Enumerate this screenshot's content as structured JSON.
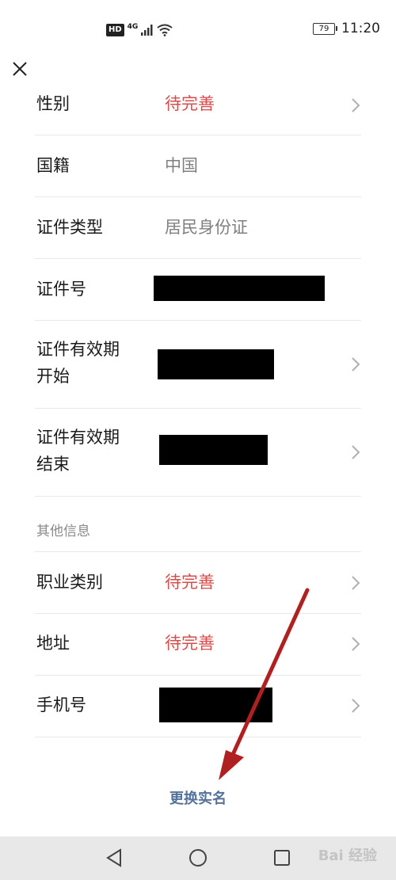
{
  "status_bar": {
    "network_badge": "HD",
    "network_type": "4G",
    "battery_level": "79",
    "time": "11:20"
  },
  "rows": [
    {
      "label": "性别",
      "value": "待完善",
      "value_style": "red",
      "chevron": true
    },
    {
      "label": "国籍",
      "value": "中国",
      "value_style": "gray",
      "chevron": false
    },
    {
      "label": "证件类型",
      "value": "居民身份证",
      "value_style": "gray",
      "chevron": false
    },
    {
      "label": "证件号",
      "value": "",
      "redacted": true,
      "chevron": false
    },
    {
      "label_line1": "证件有效期",
      "label_line2": "开始",
      "redacted": true,
      "chevron": true
    },
    {
      "label_line1": "证件有效期",
      "label_line2": "结束",
      "redacted": true,
      "chevron": true
    }
  ],
  "section_other": {
    "title": "其他信息",
    "rows": [
      {
        "label": "职业类别",
        "value": "待完善",
        "value_style": "red",
        "chevron": true
      },
      {
        "label": "地址",
        "value": "待完善",
        "value_style": "red",
        "chevron": true
      },
      {
        "label": "手机号",
        "value": "",
        "redacted": true,
        "chevron": true
      }
    ]
  },
  "change_real_name_label": "更换实名",
  "watermark": "Bai 经验",
  "colors": {
    "pending_red": "#d94b4b",
    "link_blue": "#55729b",
    "annotation_arrow": "#b02020"
  },
  "icons": [
    "close-icon",
    "chevron-right-icon",
    "back-triangle-icon",
    "home-circle-icon",
    "recents-square-icon"
  ]
}
